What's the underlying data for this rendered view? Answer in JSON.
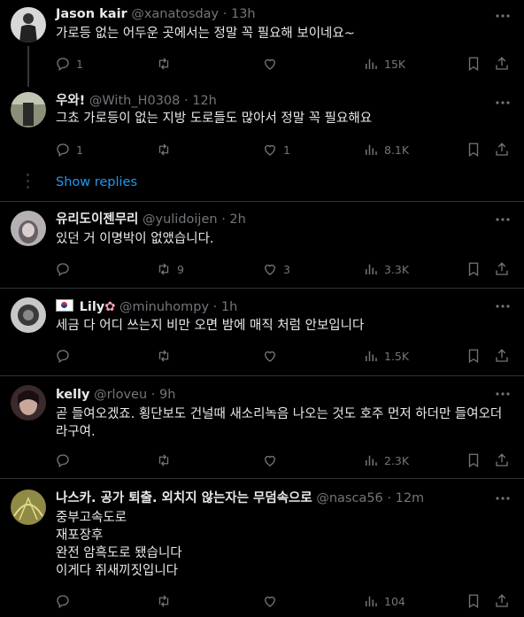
{
  "tweets": [
    {
      "name": "Jason kair",
      "handle": "@xanatosday",
      "time": "· 13h",
      "text": "가로등 없는 어두운 곳에서는 정말 꼭 필요해 보이네요~",
      "replies": "1",
      "retweets": "",
      "likes": "",
      "views": "15K"
    },
    {
      "name": "우와!",
      "handle": "@With_H0308",
      "time": "· 12h",
      "text": "그쵸 가로등이 없는 지방 도로들도 많아서 정말 꼭 필요해요",
      "replies": "1",
      "retweets": "",
      "likes": "1",
      "views": "8.1K"
    },
    {
      "name": "유리도이젠무리",
      "handle": "@yulidoijen",
      "time": "· 2h",
      "text": "있던 거 이명박이 없앴습니다.",
      "replies": "",
      "retweets": "9",
      "likes": "3",
      "views": "3.3K"
    },
    {
      "name": "Lily",
      "handle": "@minuhompy",
      "time": "· 1h",
      "text": "세금 다 어디 쓰는지 비만 오면 밤에 매직 처럼 안보입니다",
      "replies": "",
      "retweets": "",
      "likes": "",
      "views": "1.5K"
    },
    {
      "name": "kelly",
      "handle": "@rloveu",
      "time": "· 9h",
      "text": "곧 들여오겠죠. 횡단보도 건널때 새소리녹음 나오는 것도 호주 먼저 하더만 들여오더라구여.",
      "replies": "",
      "retweets": "",
      "likes": "",
      "views": "2.3K"
    },
    {
      "name": "나스카. 공가 퇴출. 외치지 않는자는 무덤속으로",
      "handle": "@nasca56",
      "time": "· 12m",
      "text": "중부고속도로\n재포장후\n완전 암흑도로 됐습니다\n이게다 쥐새끼짓입니다",
      "replies": "",
      "retweets": "",
      "likes": "",
      "views": "104"
    }
  ],
  "show_replies": "Show replies",
  "colors": {
    "accent": "#1d9bf0",
    "muted": "#71767b",
    "text": "#e7e9ea",
    "divider": "#2f3336"
  }
}
